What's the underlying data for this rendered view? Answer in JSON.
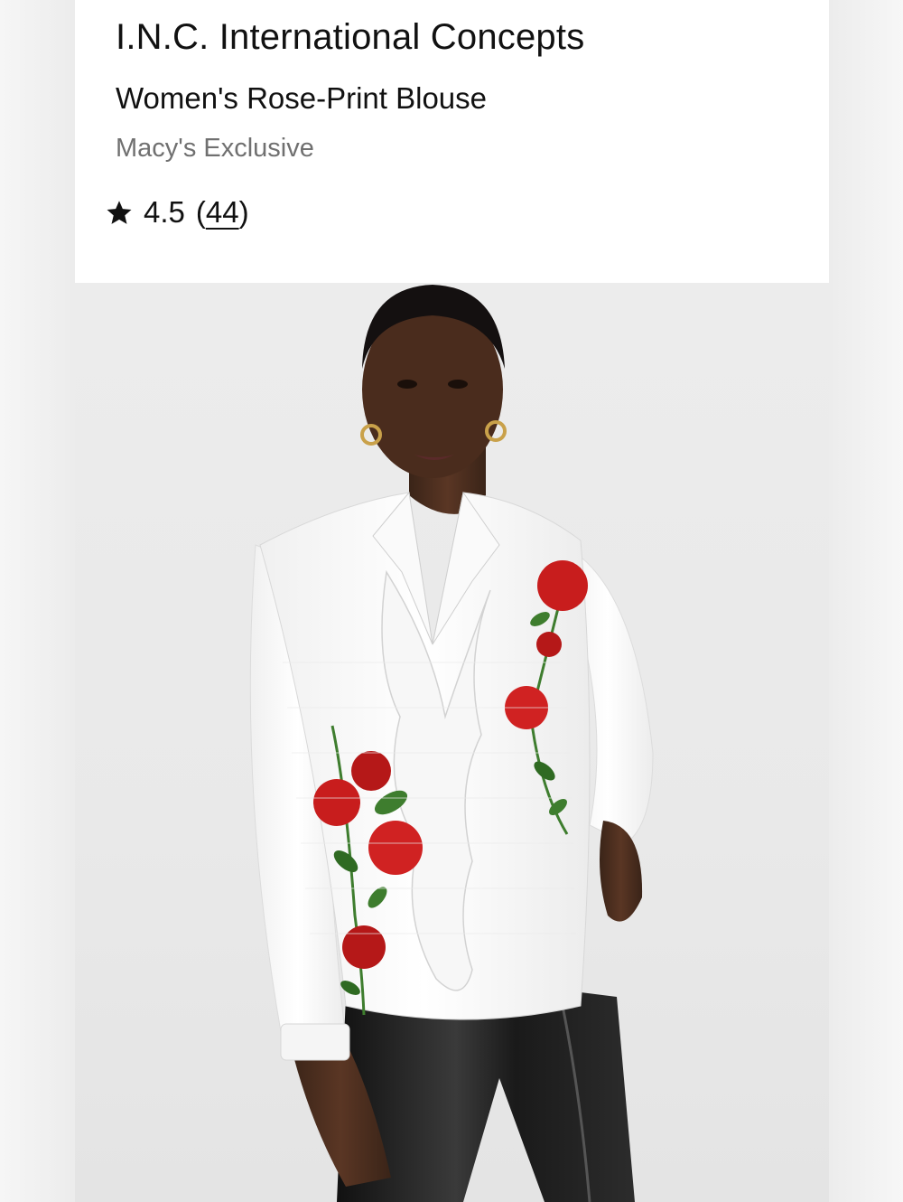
{
  "product": {
    "brand": "I.N.C. International Concepts",
    "name": "Women's Rose-Print Blouse",
    "exclusive_label": "Macy's Exclusive",
    "rating": {
      "score": "4.5",
      "open_paren": "(",
      "review_count": "44",
      "close_paren": ")",
      "icon": "star-icon"
    },
    "image": {
      "alt": "Model wearing white rose-print blouse with ruffle front and black leather pants"
    }
  },
  "colors": {
    "background": "#f1f1f1",
    "card": "#ffffff",
    "text_primary": "#111111",
    "text_secondary": "#707070",
    "rose_red": "#c81d1d",
    "leaf_green": "#3e7d2e"
  }
}
